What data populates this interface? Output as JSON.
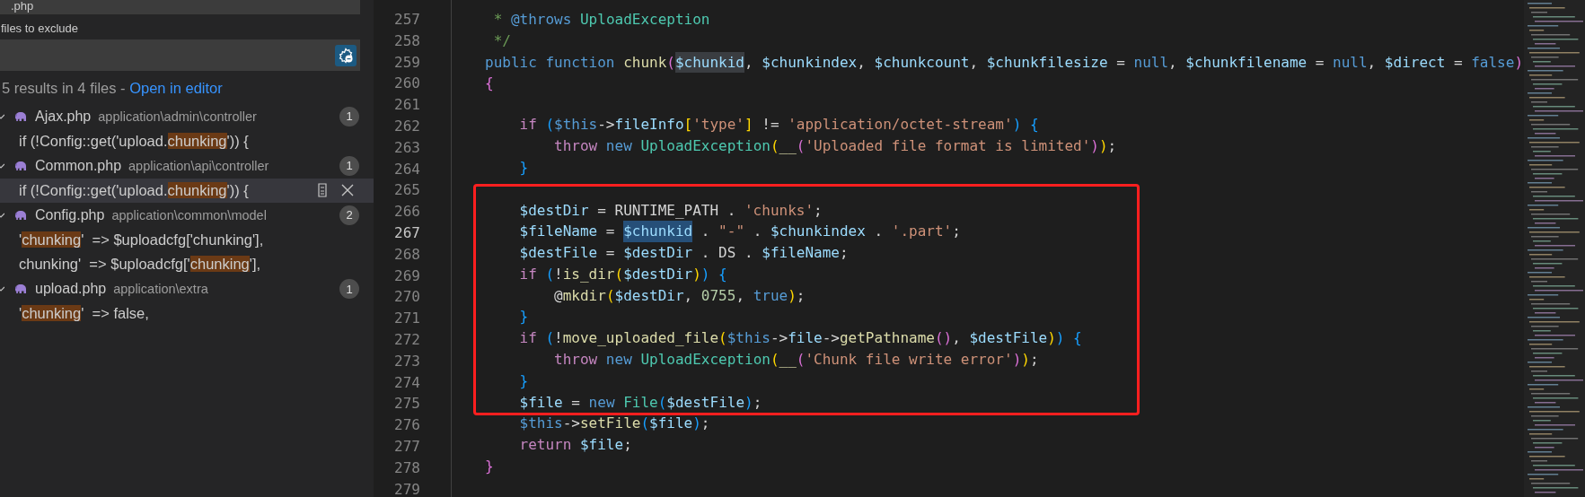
{
  "search_panel": {
    "include_field": {
      "value": ".php"
    },
    "exclude_label": "files to exclude",
    "summary": {
      "text": "5 results in 4 files - ",
      "link": "Open in editor"
    },
    "files": [
      {
        "name": "Ajax.php",
        "path": "application\\admin\\controller",
        "count": "1",
        "expanded": true,
        "matches": [
          {
            "before": "if (!Config::get('upload.",
            "match": "chunking",
            "after": "')) {",
            "selected": false
          }
        ]
      },
      {
        "name": "Common.php",
        "path": "application\\api\\controller",
        "count": "1",
        "expanded": true,
        "matches": [
          {
            "before": "if (!Config::get('upload.",
            "match": "chunking",
            "after": "')) {",
            "selected": true
          }
        ]
      },
      {
        "name": "Config.php",
        "path": "application\\common\\model",
        "count": "2",
        "expanded": true,
        "matches": [
          {
            "before": "'",
            "match": "chunking",
            "after": "'  => $uploadcfg['chunking'],",
            "selected": false
          },
          {
            "before": "chunking'  => $uploadcfg['",
            "match": "chunking",
            "after": "'],",
            "selected": false
          }
        ]
      },
      {
        "name": "upload.php",
        "path": "application\\extra",
        "count": "1",
        "expanded": true,
        "matches": [
          {
            "before": "'",
            "match": "chunking",
            "after": "'  => false,",
            "selected": false
          }
        ]
      }
    ]
  },
  "editor": {
    "lines_above": [
      {
        "number": "257",
        "current": false,
        "tokens": [
          {
            "kind": "cm",
            "text": " * "
          },
          {
            "kind": "kw",
            "text": "@throws"
          },
          {
            "kind": "cls",
            "text": " UploadException"
          }
        ]
      },
      {
        "number": "258",
        "current": false,
        "tokens": [
          {
            "kind": "cm",
            "text": " */"
          }
        ]
      },
      {
        "number": "259",
        "current": false,
        "tokens": [
          {
            "kind": "kw",
            "text": "public"
          },
          {
            "kind": "kw",
            "text": " function"
          },
          {
            "kind": "fn",
            "text": " chunk"
          },
          {
            "kind": "b2",
            "text": "("
          },
          {
            "kind": "hl",
            "text": "$chunkid"
          },
          {
            "kind": "plain",
            "text": ", "
          },
          {
            "kind": "var",
            "text": "$chunkindex"
          },
          {
            "kind": "plain",
            "text": ", "
          },
          {
            "kind": "var",
            "text": "$chunkcount"
          },
          {
            "kind": "plain",
            "text": ", "
          },
          {
            "kind": "var",
            "text": "$chunkfilesize"
          },
          {
            "kind": "plain",
            "text": " = "
          },
          {
            "kind": "lit",
            "text": "null"
          },
          {
            "kind": "plain",
            "text": ", "
          },
          {
            "kind": "var",
            "text": "$chunkfilename"
          },
          {
            "kind": "plain",
            "text": " = "
          },
          {
            "kind": "lit",
            "text": "null"
          },
          {
            "kind": "plain",
            "text": ", "
          },
          {
            "kind": "var",
            "text": "$direct"
          },
          {
            "kind": "plain",
            "text": " = "
          },
          {
            "kind": "lit",
            "text": "false"
          },
          {
            "kind": "b2",
            "text": ")"
          }
        ]
      },
      {
        "number": "260",
        "current": false,
        "tokens": [
          {
            "kind": "b2",
            "text": "{"
          }
        ]
      },
      {
        "number": "261",
        "current": false
      },
      {
        "number": "262",
        "current": false,
        "tokens": [
          {
            "kind": "ctl",
            "text": "    if"
          },
          {
            "kind": "b3",
            "text": " ("
          },
          {
            "kind": "kw",
            "text": "$this"
          },
          {
            "kind": "plain",
            "text": "->"
          },
          {
            "kind": "var",
            "text": "fileInfo"
          },
          {
            "kind": "b1",
            "text": "["
          },
          {
            "kind": "str",
            "text": "'type'"
          },
          {
            "kind": "b1",
            "text": "]"
          },
          {
            "kind": "plain",
            "text": " != "
          },
          {
            "kind": "str",
            "text": "'application/octet-stream'"
          },
          {
            "kind": "b3",
            "text": ")"
          },
          {
            "kind": "b3",
            "text": " {"
          }
        ]
      },
      {
        "number": "263",
        "current": false,
        "tokens": [
          {
            "kind": "ctl",
            "text": "        throw"
          },
          {
            "kind": "kw",
            "text": " new"
          },
          {
            "kind": "cls",
            "text": " UploadException"
          },
          {
            "kind": "b1",
            "text": "("
          },
          {
            "kind": "fn",
            "text": "__"
          },
          {
            "kind": "b2",
            "text": "("
          },
          {
            "kind": "str",
            "text": "'Uploaded file format is limited'"
          },
          {
            "kind": "b2",
            "text": ")"
          },
          {
            "kind": "b1",
            "text": ")"
          },
          {
            "kind": "plain",
            "text": ";"
          }
        ]
      },
      {
        "number": "264",
        "current": false,
        "tokens": [
          {
            "kind": "b3",
            "text": "    }"
          }
        ]
      }
    ],
    "framed": {
      "lines": [
        {
          "number": "265",
          "current": false
        },
        {
          "number": "266",
          "current": false,
          "tokens": [
            {
              "kind": "var",
              "text": "    $destDir"
            },
            {
              "kind": "plain",
              "text": " = RUNTIME_PATH . "
            },
            {
              "kind": "str",
              "text": "'chunks'"
            },
            {
              "kind": "plain",
              "text": ";"
            }
          ]
        },
        {
          "number": "267",
          "current": true,
          "tokens": [
            {
              "kind": "var",
              "text": "    $fileName"
            },
            {
              "kind": "plain",
              "text": " = "
            },
            {
              "kind": "sel",
              "text": "$chunkid"
            },
            {
              "kind": "plain",
              "text": " . "
            },
            {
              "kind": "str",
              "text": "\"-\""
            },
            {
              "kind": "plain",
              "text": " . "
            },
            {
              "kind": "var",
              "text": "$chunkindex"
            },
            {
              "kind": "plain",
              "text": " . "
            },
            {
              "kind": "str",
              "text": "'.part'"
            },
            {
              "kind": "plain",
              "text": ";"
            }
          ]
        },
        {
          "number": "268",
          "current": false,
          "tokens": [
            {
              "kind": "var",
              "text": "    $destFile"
            },
            {
              "kind": "plain",
              "text": " = "
            },
            {
              "kind": "var",
              "text": "$destDir"
            },
            {
              "kind": "plain",
              "text": " . DS . "
            },
            {
              "kind": "var",
              "text": "$fileName"
            },
            {
              "kind": "plain",
              "text": ";"
            }
          ]
        },
        {
          "number": "269",
          "current": false,
          "tokens": [
            {
              "kind": "ctl",
              "text": "    if"
            },
            {
              "kind": "b3",
              "text": " ("
            },
            {
              "kind": "plain",
              "text": "!"
            },
            {
              "kind": "fn",
              "text": "is_dir"
            },
            {
              "kind": "b1",
              "text": "("
            },
            {
              "kind": "var",
              "text": "$destDir"
            },
            {
              "kind": "b1",
              "text": ")"
            },
            {
              "kind": "b3",
              "text": ")"
            },
            {
              "kind": "b3",
              "text": " {"
            }
          ]
        },
        {
          "number": "270",
          "current": false,
          "tokens": [
            {
              "kind": "plain",
              "text": "        @"
            },
            {
              "kind": "fn",
              "text": "mkdir"
            },
            {
              "kind": "b1",
              "text": "("
            },
            {
              "kind": "var",
              "text": "$destDir"
            },
            {
              "kind": "plain",
              "text": ", "
            },
            {
              "kind": "num",
              "text": "0755"
            },
            {
              "kind": "plain",
              "text": ", "
            },
            {
              "kind": "lit",
              "text": "true"
            },
            {
              "kind": "b1",
              "text": ")"
            },
            {
              "kind": "plain",
              "text": ";"
            }
          ]
        },
        {
          "number": "271",
          "current": false,
          "tokens": [
            {
              "kind": "b3",
              "text": "    }"
            }
          ]
        },
        {
          "number": "272",
          "current": false,
          "tokens": [
            {
              "kind": "ctl",
              "text": "    if"
            },
            {
              "kind": "b3",
              "text": " ("
            },
            {
              "kind": "plain",
              "text": "!"
            },
            {
              "kind": "fn",
              "text": "move_uploaded_file"
            },
            {
              "kind": "b1",
              "text": "("
            },
            {
              "kind": "kw",
              "text": "$this"
            },
            {
              "kind": "plain",
              "text": "->"
            },
            {
              "kind": "var",
              "text": "file"
            },
            {
              "kind": "plain",
              "text": "->"
            },
            {
              "kind": "fn",
              "text": "getPathname"
            },
            {
              "kind": "b2",
              "text": "()"
            },
            {
              "kind": "plain",
              "text": ", "
            },
            {
              "kind": "var",
              "text": "$destFile"
            },
            {
              "kind": "b1",
              "text": ")"
            },
            {
              "kind": "b3",
              "text": ")"
            },
            {
              "kind": "b3",
              "text": " {"
            }
          ]
        },
        {
          "number": "273",
          "current": false,
          "tokens": [
            {
              "kind": "ctl",
              "text": "        throw"
            },
            {
              "kind": "kw",
              "text": " new"
            },
            {
              "kind": "cls",
              "text": " UploadException"
            },
            {
              "kind": "b1",
              "text": "("
            },
            {
              "kind": "fn",
              "text": "__"
            },
            {
              "kind": "b2",
              "text": "("
            },
            {
              "kind": "str",
              "text": "'Chunk file write error'"
            },
            {
              "kind": "b2",
              "text": ")"
            },
            {
              "kind": "b1",
              "text": ")"
            },
            {
              "kind": "plain",
              "text": ";"
            }
          ]
        },
        {
          "number": "274",
          "current": false,
          "tokens": [
            {
              "kind": "b3",
              "text": "    }"
            }
          ]
        },
        {
          "number": "275",
          "current": false,
          "tokens": [
            {
              "kind": "var",
              "text": "    $file"
            },
            {
              "kind": "plain",
              "text": " = "
            },
            {
              "kind": "kw",
              "text": "new"
            },
            {
              "kind": "cls",
              "text": " File"
            },
            {
              "kind": "b3",
              "text": "("
            },
            {
              "kind": "var",
              "text": "$destFile"
            },
            {
              "kind": "b3",
              "text": ")"
            },
            {
              "kind": "plain",
              "text": ";"
            }
          ]
        }
      ]
    },
    "lines_below": [
      {
        "number": "276",
        "current": false,
        "tokens": [
          {
            "kind": "kw",
            "text": "    $this"
          },
          {
            "kind": "plain",
            "text": "->"
          },
          {
            "kind": "fn",
            "text": "setFile"
          },
          {
            "kind": "b3",
            "text": "("
          },
          {
            "kind": "var",
            "text": "$file"
          },
          {
            "kind": "b3",
            "text": ")"
          },
          {
            "kind": "plain",
            "text": ";"
          }
        ]
      },
      {
        "number": "277",
        "current": false,
        "tokens": [
          {
            "kind": "ctl",
            "text": "    return"
          },
          {
            "kind": "var",
            "text": " $file"
          },
          {
            "kind": "plain",
            "text": ";"
          }
        ]
      },
      {
        "number": "278",
        "current": false,
        "tokens": [
          {
            "kind": "b2",
            "text": "}"
          }
        ]
      },
      {
        "number": "279",
        "current": false
      }
    ]
  }
}
